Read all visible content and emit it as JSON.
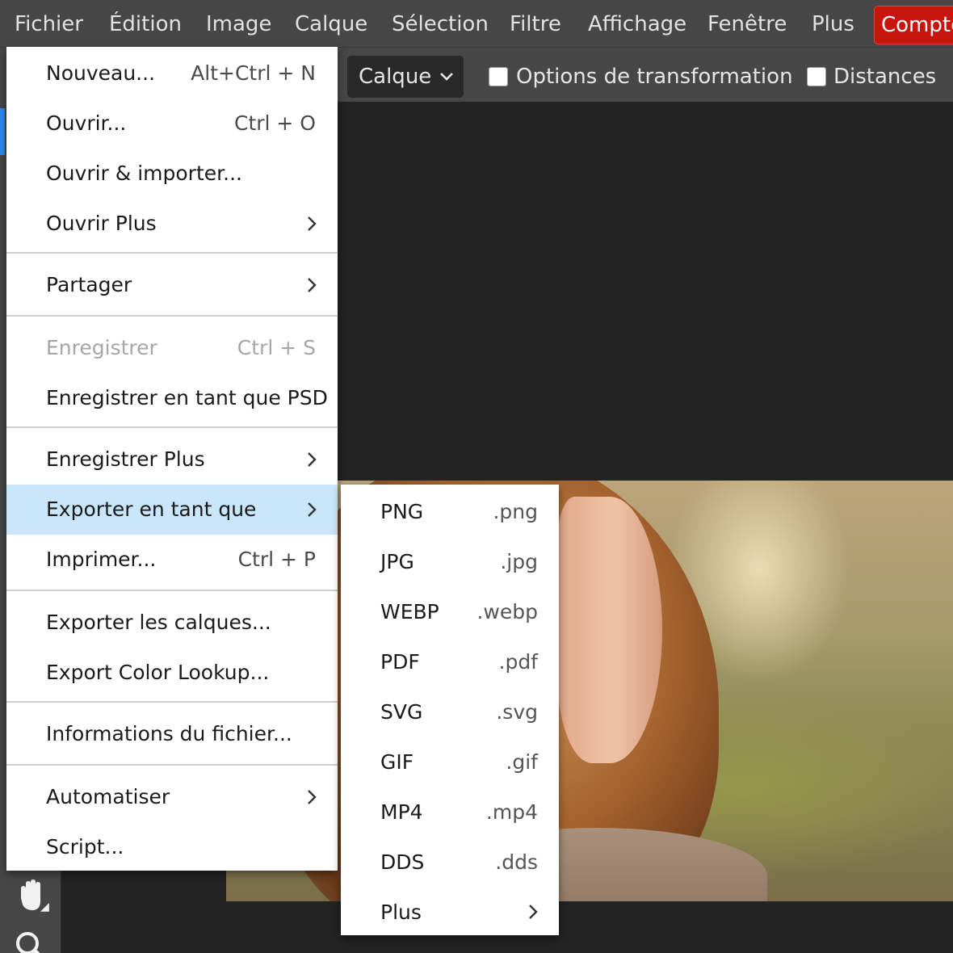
{
  "menubar": {
    "items": [
      "Fichier",
      "Édition",
      "Image",
      "Calque",
      "Sélection",
      "Filtre",
      "Affichage",
      "Fenêtre",
      "Plus"
    ],
    "account": "Compte"
  },
  "optionsbar": {
    "layer_select": "Calque",
    "transform_options_label": "Options de transformation",
    "transform_options_checked": false,
    "distances_label": "Distances",
    "distances_checked": false
  },
  "file_menu": {
    "items": [
      {
        "label": "Nouveau...",
        "shortcut": "Alt+Ctrl + N"
      },
      {
        "label": "Ouvrir...",
        "shortcut": "Ctrl + O"
      },
      {
        "label": "Ouvrir & importer..."
      },
      {
        "label": "Ouvrir Plus",
        "submenu": true
      },
      {
        "label": "Partager",
        "submenu": true
      },
      {
        "label": "Enregistrer",
        "shortcut": "Ctrl + S",
        "disabled": true
      },
      {
        "label": "Enregistrer en tant que PSD"
      },
      {
        "label": "Enregistrer Plus",
        "submenu": true
      },
      {
        "label": "Exporter en tant que",
        "submenu": true,
        "highlighted": true
      },
      {
        "label": "Imprimer...",
        "shortcut": "Ctrl + P"
      },
      {
        "label": "Exporter les calques..."
      },
      {
        "label": "Export Color Lookup..."
      },
      {
        "label": "Informations du fichier..."
      },
      {
        "label": "Automatiser",
        "submenu": true
      },
      {
        "label": "Script..."
      }
    ]
  },
  "export_menu": {
    "items": [
      {
        "format": "PNG",
        "ext": ".png"
      },
      {
        "format": "JPG",
        "ext": ".jpg"
      },
      {
        "format": "WEBP",
        "ext": ".webp"
      },
      {
        "format": "PDF",
        "ext": ".pdf"
      },
      {
        "format": "SVG",
        "ext": ".svg"
      },
      {
        "format": "GIF",
        "ext": ".gif"
      },
      {
        "format": "MP4",
        "ext": ".mp4"
      },
      {
        "format": "DDS",
        "ext": ".dds"
      },
      {
        "format": "Plus",
        "submenu": true
      }
    ]
  },
  "icons": {
    "chevron_right": "chevron-right-icon",
    "chevron_down": "chevron-down-icon",
    "hand_tool": "hand-icon",
    "zoom_tool": "magnifier-icon"
  },
  "colors": {
    "menubar_bg": "#474747",
    "canvas_bg": "#232323",
    "account_red": "#c8150d",
    "menu_highlight": "#c9e6fb",
    "active_tool_blue": "#2d8ceb"
  }
}
